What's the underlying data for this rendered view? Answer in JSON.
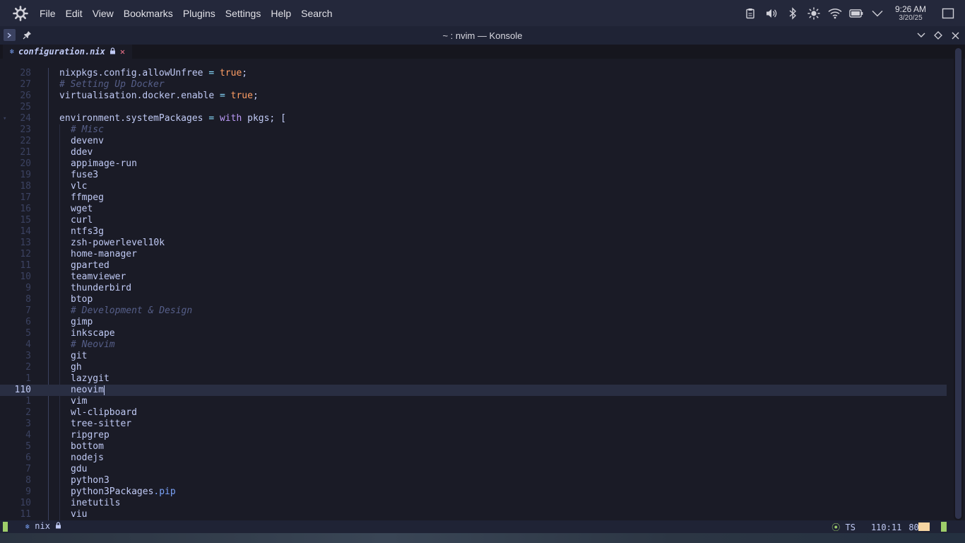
{
  "topbar": {
    "menu": [
      "File",
      "Edit",
      "View",
      "Bookmarks",
      "Plugins",
      "Settings",
      "Help",
      "Search"
    ],
    "tray_icons": [
      "clipboard-icon",
      "volume-icon",
      "bluetooth-icon",
      "brightness-icon",
      "wifi-icon",
      "battery-icon",
      "expand-tray-icon"
    ],
    "time": "9:26 AM",
    "date": "3/20/25"
  },
  "window": {
    "title": "~ : nvim — Konsole"
  },
  "tab": {
    "filename": "configuration.nix"
  },
  "editor": {
    "lines": [
      {
        "num": "28",
        "tokens": [
          [
            "nixpkgs.config.allowUnfree",
            "id"
          ],
          [
            " = ",
            "op"
          ],
          [
            "true",
            "bool"
          ],
          [
            ";",
            "pun"
          ]
        ],
        "indent": 0
      },
      {
        "num": "27",
        "tokens": [
          [
            "# Setting Up Docker",
            "com"
          ]
        ],
        "indent": 0
      },
      {
        "num": "26",
        "tokens": [
          [
            "virtualisation.docker.enable",
            "id"
          ],
          [
            " = ",
            "op"
          ],
          [
            "true",
            "bool"
          ],
          [
            ";",
            "pun"
          ]
        ],
        "indent": 0
      },
      {
        "num": "25",
        "tokens": [],
        "indent": 0
      },
      {
        "num": "24",
        "tokens": [
          [
            "environment.systemPackages",
            "id"
          ],
          [
            " = ",
            "op"
          ],
          [
            "with",
            "kw"
          ],
          [
            " pkgs; [",
            "pun"
          ]
        ],
        "indent": 0,
        "fold": true
      },
      {
        "num": "23",
        "tokens": [
          [
            "# Misc",
            "com"
          ]
        ],
        "indent": 1
      },
      {
        "num": "22",
        "tokens": [
          [
            "devenv",
            "id"
          ]
        ],
        "indent": 1
      },
      {
        "num": "21",
        "tokens": [
          [
            "ddev",
            "id"
          ]
        ],
        "indent": 1
      },
      {
        "num": "20",
        "tokens": [
          [
            "appimage-run",
            "id"
          ]
        ],
        "indent": 1
      },
      {
        "num": "19",
        "tokens": [
          [
            "fuse3",
            "id"
          ]
        ],
        "indent": 1
      },
      {
        "num": "18",
        "tokens": [
          [
            "vlc",
            "id"
          ]
        ],
        "indent": 1
      },
      {
        "num": "17",
        "tokens": [
          [
            "ffmpeg",
            "id"
          ]
        ],
        "indent": 1
      },
      {
        "num": "16",
        "tokens": [
          [
            "wget",
            "id"
          ]
        ],
        "indent": 1
      },
      {
        "num": "15",
        "tokens": [
          [
            "curl",
            "id"
          ]
        ],
        "indent": 1
      },
      {
        "num": "14",
        "tokens": [
          [
            "ntfs3g",
            "id"
          ]
        ],
        "indent": 1
      },
      {
        "num": "13",
        "tokens": [
          [
            "zsh-powerlevel10k",
            "id"
          ]
        ],
        "indent": 1
      },
      {
        "num": "12",
        "tokens": [
          [
            "home-manager",
            "id"
          ]
        ],
        "indent": 1
      },
      {
        "num": "11",
        "tokens": [
          [
            "gparted",
            "id"
          ]
        ],
        "indent": 1
      },
      {
        "num": "10",
        "tokens": [
          [
            "teamviewer",
            "id"
          ]
        ],
        "indent": 1
      },
      {
        "num": "9",
        "tokens": [
          [
            "thunderbird",
            "id"
          ]
        ],
        "indent": 1
      },
      {
        "num": "8",
        "tokens": [
          [
            "btop",
            "id"
          ]
        ],
        "indent": 1
      },
      {
        "num": "7",
        "tokens": [
          [
            "# Development & Design",
            "com"
          ]
        ],
        "indent": 1
      },
      {
        "num": "6",
        "tokens": [
          [
            "gimp",
            "id"
          ]
        ],
        "indent": 1
      },
      {
        "num": "5",
        "tokens": [
          [
            "inkscape",
            "id"
          ]
        ],
        "indent": 1
      },
      {
        "num": "4",
        "tokens": [
          [
            "# Neovim",
            "com"
          ]
        ],
        "indent": 1
      },
      {
        "num": "3",
        "tokens": [
          [
            "git",
            "id"
          ]
        ],
        "indent": 1
      },
      {
        "num": "2",
        "tokens": [
          [
            "gh",
            "id"
          ]
        ],
        "indent": 1
      },
      {
        "num": "1",
        "tokens": [
          [
            "lazygit",
            "id"
          ]
        ],
        "indent": 1
      },
      {
        "num": "110",
        "tokens": [
          [
            "neovim",
            "id"
          ]
        ],
        "indent": 1,
        "current": true
      },
      {
        "num": "1",
        "tokens": [
          [
            "vim",
            "id"
          ]
        ],
        "indent": 1
      },
      {
        "num": "2",
        "tokens": [
          [
            "wl-clipboard",
            "id"
          ]
        ],
        "indent": 1
      },
      {
        "num": "3",
        "tokens": [
          [
            "tree-sitter",
            "id"
          ]
        ],
        "indent": 1
      },
      {
        "num": "4",
        "tokens": [
          [
            "ripgrep",
            "id"
          ]
        ],
        "indent": 1
      },
      {
        "num": "5",
        "tokens": [
          [
            "bottom",
            "id"
          ]
        ],
        "indent": 1
      },
      {
        "num": "6",
        "tokens": [
          [
            "nodejs",
            "id"
          ]
        ],
        "indent": 1
      },
      {
        "num": "7",
        "tokens": [
          [
            "gdu",
            "id"
          ]
        ],
        "indent": 1
      },
      {
        "num": "8",
        "tokens": [
          [
            "python3",
            "id"
          ]
        ],
        "indent": 1
      },
      {
        "num": "9",
        "tokens": [
          [
            "python3Packages",
            "id"
          ],
          [
            ".pip",
            "attr"
          ]
        ],
        "indent": 1
      },
      {
        "num": "10",
        "tokens": [
          [
            "inetutils",
            "id"
          ]
        ],
        "indent": 1
      },
      {
        "num": "11",
        "tokens": [
          [
            "viu",
            "id"
          ]
        ],
        "indent": 1
      }
    ]
  },
  "statusline": {
    "filetype": "nix",
    "ts": "TS",
    "position": "110:11",
    "percent": "80%"
  },
  "colors": {
    "background": "#1a1b26",
    "accent_green": "#9ece6a",
    "keyword": "#bb9af7",
    "boolean": "#ff9e64",
    "comment": "#565f89"
  }
}
